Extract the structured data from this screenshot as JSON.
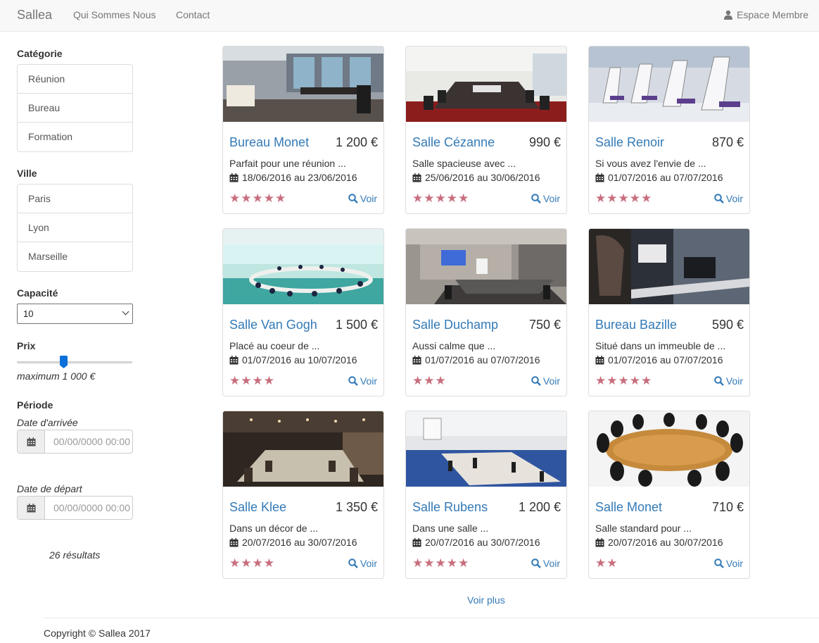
{
  "navbar": {
    "brand": "Sallea",
    "links": [
      "Qui Sommes Nous",
      "Contact"
    ],
    "member": "Espace Membre"
  },
  "sidebar": {
    "category_title": "Catégorie",
    "categories": [
      "Réunion",
      "Bureau",
      "Formation"
    ],
    "city_title": "Ville",
    "cities": [
      "Paris",
      "Lyon",
      "Marseille"
    ],
    "capacity_title": "Capacité",
    "capacity_value": "10",
    "price_title": "Prix",
    "price_max_label": "maximum 1 000 €",
    "price_slider_fraction": 0.4,
    "period_title": "Période",
    "arrival_label": "Date d'arrivée",
    "arrival_placeholder": "00/00/0000 00:00",
    "departure_label": "Date de départ",
    "departure_placeholder": "00/00/0000 00:00",
    "results": "26 résultats"
  },
  "cards": [
    {
      "name": "Bureau Monet",
      "price": "1 200 €",
      "desc": "Parfait pour une réunion ...",
      "dates": "18/06/2016 au 23/06/2016",
      "stars": "★★★★★",
      "rating": 5,
      "voir": "Voir"
    },
    {
      "name": "Salle Cézanne",
      "price": "990 €",
      "desc": "Salle spacieuse avec ...",
      "dates": "25/06/2016 au 30/06/2016",
      "stars": "★★★★★",
      "rating": 5,
      "voir": "Voir"
    },
    {
      "name": "Salle Renoir",
      "price": "870 €",
      "desc": "Si vous avez l'envie de ...",
      "dates": "01/07/2016 au 07/07/2016",
      "stars": "★★★★★",
      "rating": 5,
      "voir": "Voir"
    },
    {
      "name": "Salle Van Gogh",
      "price": "1 500 €",
      "desc": "Placé au coeur de ...",
      "dates": "01/07/2016 au 10/07/2016",
      "stars": "★★★★",
      "rating": 4,
      "voir": "Voir"
    },
    {
      "name": "Salle Duchamp",
      "price": "750 €",
      "desc": "Aussi calme que ...",
      "dates": "01/07/2016 au 07/07/2016",
      "stars": "★★★",
      "rating": 3,
      "voir": "Voir"
    },
    {
      "name": "Bureau Bazille",
      "price": "590 €",
      "desc": "Situé dans un immeuble de ...",
      "dates": "01/07/2016 au 07/07/2016",
      "stars": "★★★★★",
      "rating": 5,
      "voir": "Voir"
    },
    {
      "name": "Salle Klee",
      "price": "1 350 €",
      "desc": "Dans un décor de ...",
      "dates": "20/07/2016 au 30/07/2016",
      "stars": "★★★★",
      "rating": 4,
      "voir": "Voir"
    },
    {
      "name": "Salle Rubens",
      "price": "1 200 €",
      "desc": "Dans une salle ...",
      "dates": "20/07/2016 au 30/07/2016",
      "stars": "★★★★★",
      "rating": 5,
      "voir": "Voir"
    },
    {
      "name": "Salle Monet",
      "price": "710 €",
      "desc": "Salle standard pour ...",
      "dates": "20/07/2016 au 30/07/2016",
      "stars": "★★",
      "rating": 2,
      "voir": "Voir"
    }
  ],
  "voir_plus": "Voir plus",
  "footer": {
    "copyright": "Copyright © Sallea 2017"
  },
  "colors": {
    "link": "#337ab7",
    "star": "#c86e7e",
    "slider": "#0a6fd8"
  },
  "icons": {
    "member": "user-icon",
    "calendar": "calendar-icon",
    "search": "search-icon"
  }
}
